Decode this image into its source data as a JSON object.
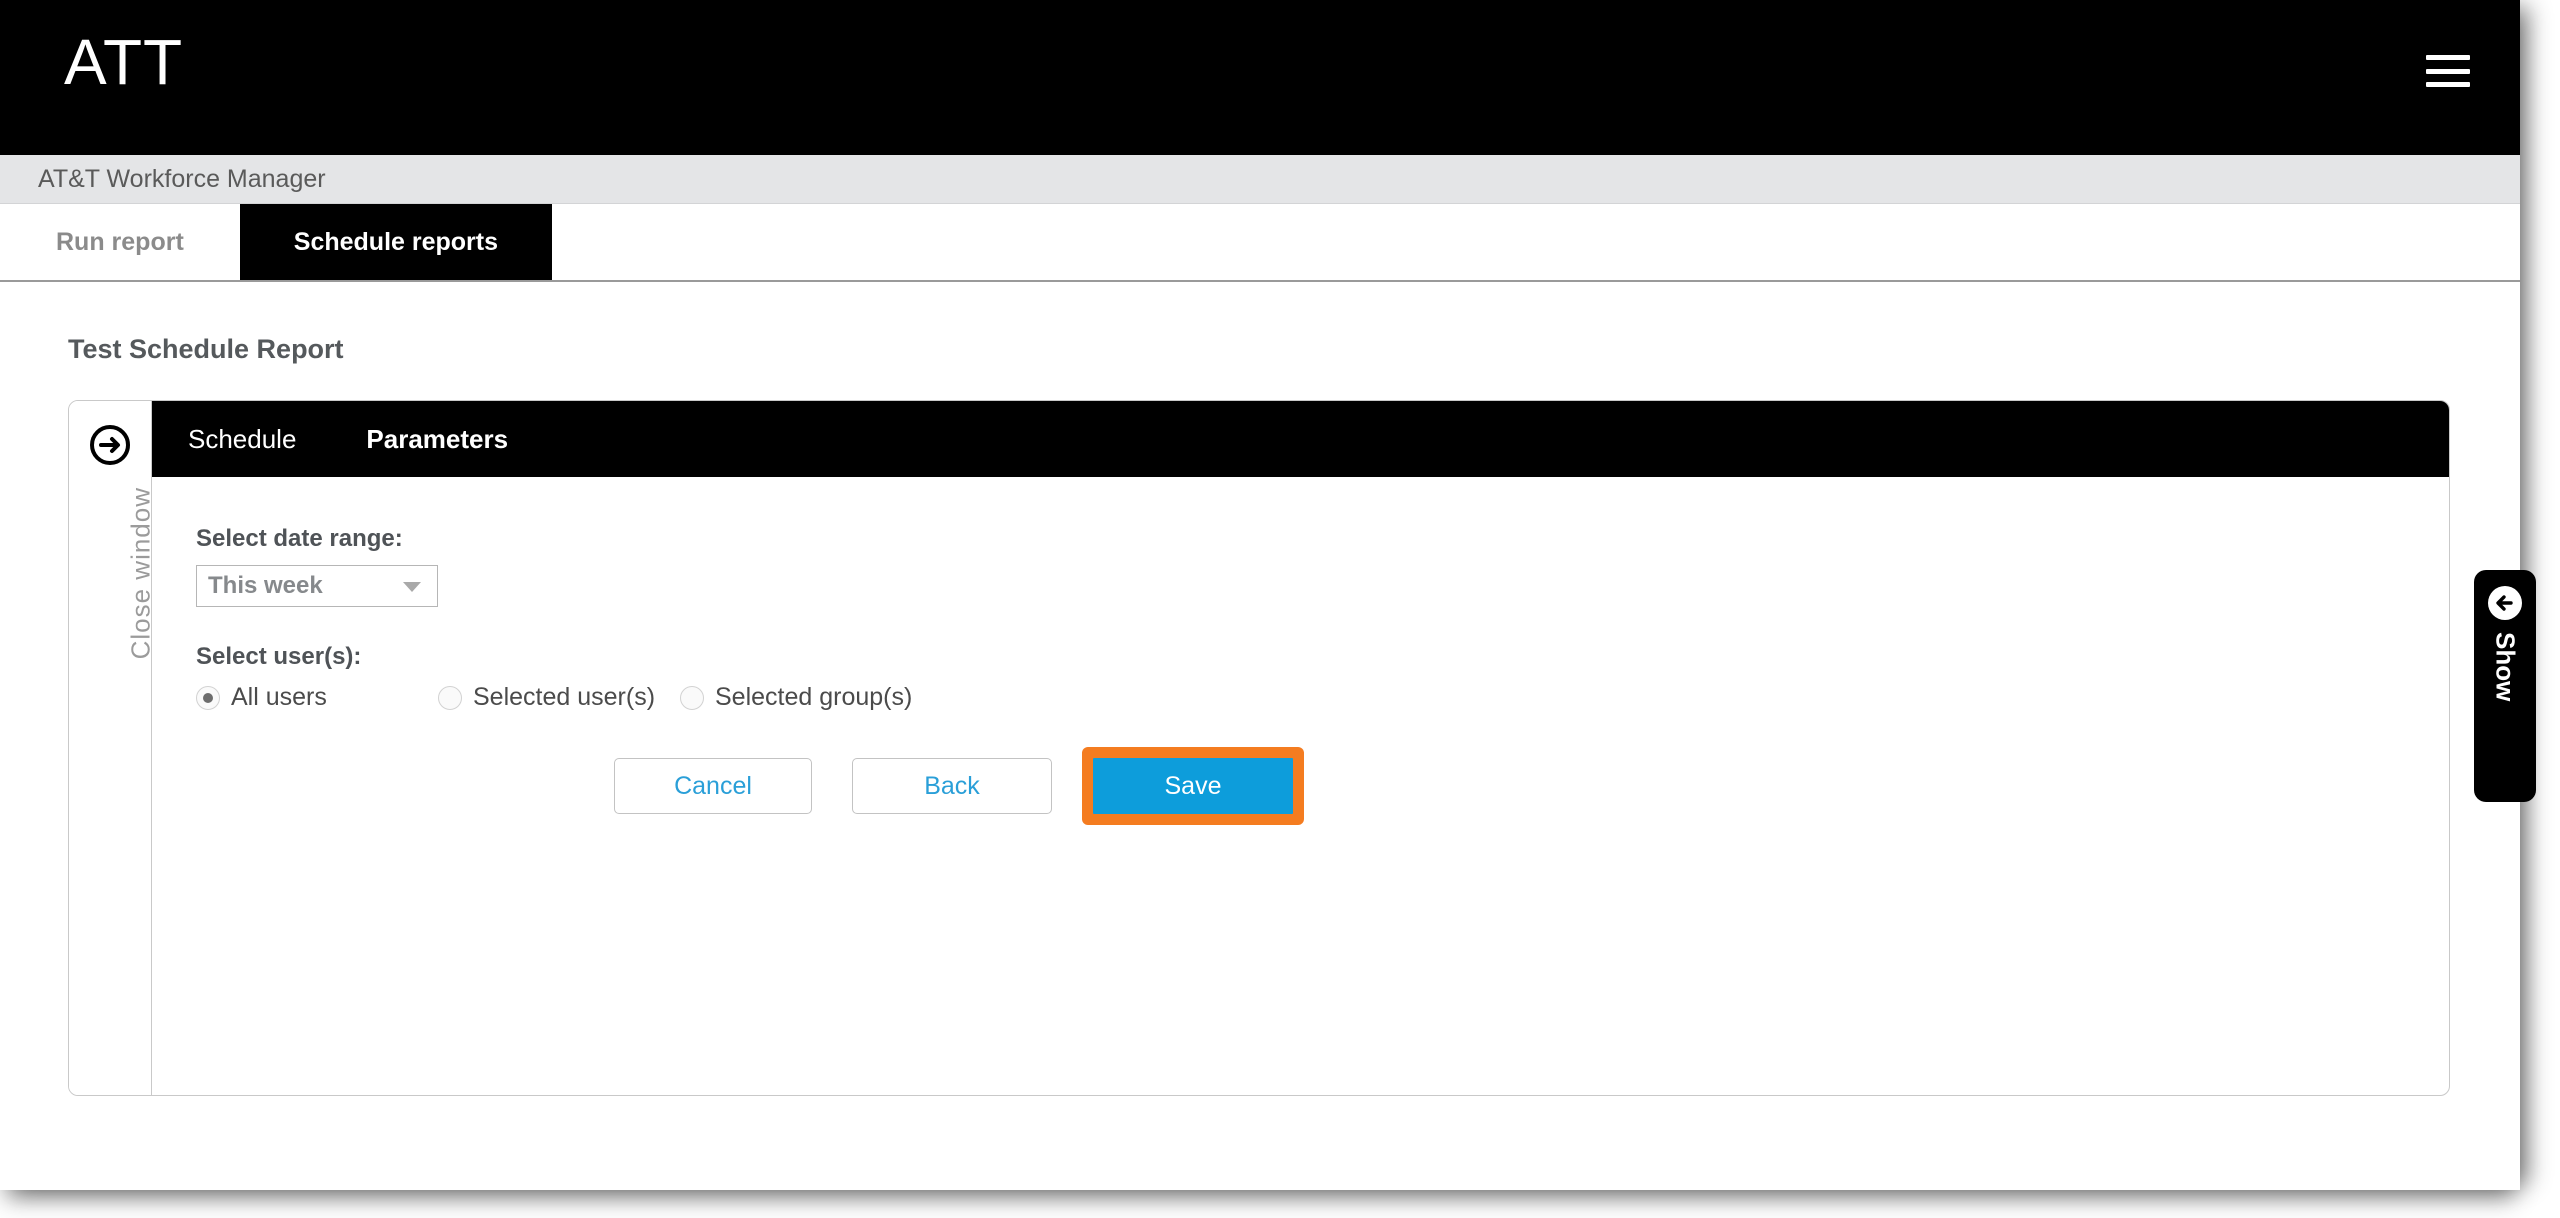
{
  "header": {
    "logo_text": "ATT",
    "menu_icon": "hamburger-menu-icon",
    "app_name": "AT&T Workforce Manager"
  },
  "tabs": [
    {
      "label": "Run report",
      "active": false
    },
    {
      "label": "Schedule reports",
      "active": true
    }
  ],
  "page": {
    "title": "Test Schedule Report"
  },
  "window": {
    "close_rail": {
      "icon": "arrow-right-circle-icon",
      "label": "Close window"
    },
    "panel_tabs": [
      {
        "label": "Schedule",
        "active": false
      },
      {
        "label": "Parameters",
        "active": true
      }
    ],
    "form": {
      "date_range": {
        "label": "Select date range:",
        "value": "This week",
        "caret_icon": "chevron-down-icon"
      },
      "users": {
        "label": "Select user(s):",
        "options": [
          {
            "label": "All users",
            "selected": true
          },
          {
            "label": "Selected user(s)",
            "selected": false
          },
          {
            "label": "Selected group(s)",
            "selected": false
          }
        ]
      }
    },
    "buttons": {
      "cancel": "Cancel",
      "back": "Back",
      "save": "Save"
    }
  },
  "show_tab": {
    "icon": "arrow-left-circle-icon",
    "label": "Show"
  },
  "colors": {
    "brand_black": "#000000",
    "subbar_gray": "#e4e5e7",
    "primary_blue": "#0d9ddb",
    "link_blue": "#2a9fd8",
    "highlight_orange": "#f47c20",
    "text_gray": "#55595c"
  }
}
